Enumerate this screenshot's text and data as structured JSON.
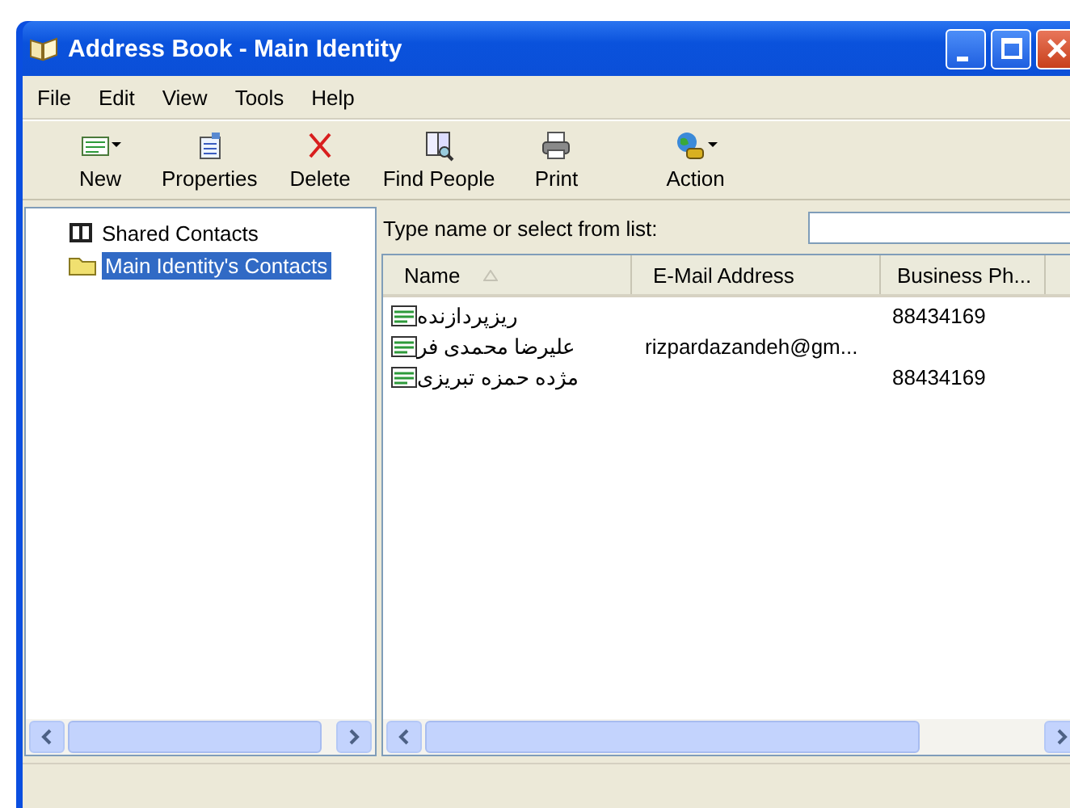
{
  "window": {
    "title": "Address Book - Main Identity"
  },
  "menu": [
    "File",
    "Edit",
    "View",
    "Tools",
    "Help"
  ],
  "toolbar": [
    {
      "label": "New",
      "dropdown": true
    },
    {
      "label": "Properties",
      "dropdown": false
    },
    {
      "label": "Delete",
      "dropdown": false
    },
    {
      "label": "Find People",
      "dropdown": false
    },
    {
      "label": "Print",
      "dropdown": false
    },
    {
      "label": "Action",
      "dropdown": true
    }
  ],
  "tree": [
    {
      "label": "Shared Contacts",
      "selected": false
    },
    {
      "label": "Main Identity's Contacts",
      "selected": true
    }
  ],
  "search": {
    "label": "Type name or select from list:"
  },
  "table": {
    "columns": [
      {
        "label": "Name",
        "sorted": true
      },
      {
        "label": "E-Mail Address",
        "sorted": false
      },
      {
        "label": "Business Ph...",
        "sorted": false
      }
    ],
    "rows": [
      {
        "name": "ریزپردازنده",
        "phone": "88434169"
      },
      {
        "name": "علیرضا محمدی فر",
        "email": "rizpardazandeh@gm..."
      },
      {
        "name": "مژده حمزه تبریزی",
        "phone": "88434169"
      }
    ]
  }
}
